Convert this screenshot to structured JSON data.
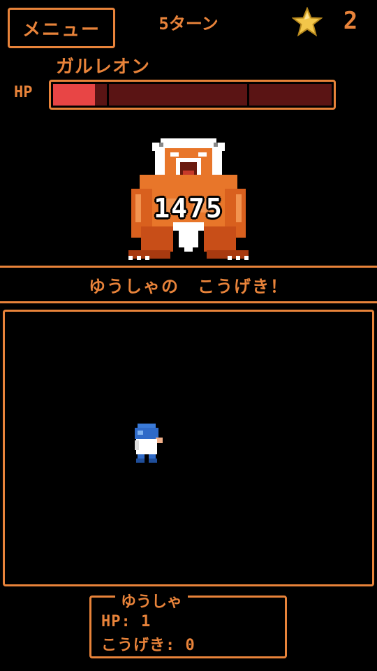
{
  "header": {
    "menu_label": "メニュー",
    "turn_label": "5ターン",
    "stars": "2",
    "star_icon": "star-icon"
  },
  "enemy": {
    "name": "ガルレオン",
    "hp_label": "HP",
    "hp_fraction": 0.15,
    "damage": "1475",
    "colors": {
      "hp_fill": "#e84545",
      "hp_empty": "#5a1414"
    }
  },
  "message": "ゆうしゃの　こうげき！",
  "hero_status": {
    "name": "ゆうしゃ",
    "hp_line": "HP: 1",
    "attack_line": "こうげき: 0"
  },
  "colors": {
    "accent": "#e8833a",
    "background": "#000000"
  }
}
